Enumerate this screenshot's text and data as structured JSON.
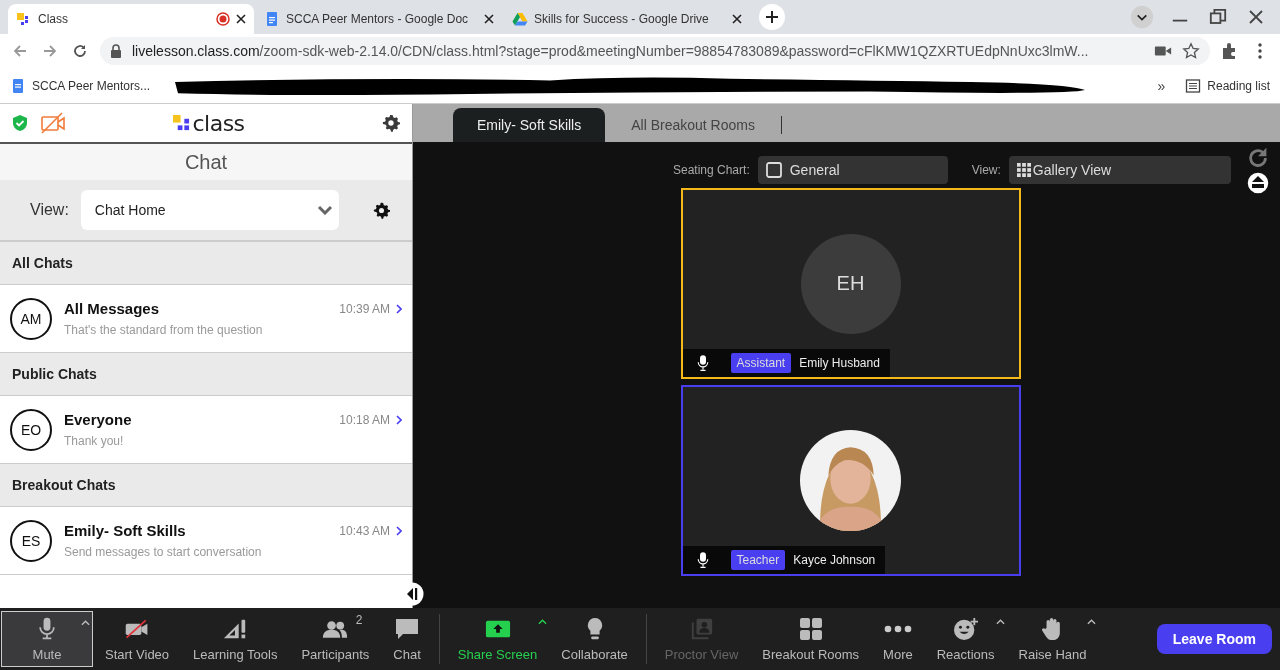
{
  "browser": {
    "tabs": [
      {
        "kind": "class",
        "title": "Class",
        "selected": true,
        "recording": true
      },
      {
        "kind": "doc",
        "title": "SCCA Peer Mentors - Google Doc",
        "selected": false,
        "recording": false
      },
      {
        "kind": "drive",
        "title": "Skills for Success - Google Drive",
        "selected": false,
        "recording": false
      }
    ],
    "url": {
      "host": "livelesson.class.com",
      "path": "/zoom-sdk-web-2.14.0/CDN/class.html?stage=prod&meetingNumber=98854783089&password=cFlKMW1QZXRTUEdpNnUxc3lmW..."
    },
    "bookmarks": [
      {
        "label": "SCCA Peer Mentors..."
      }
    ],
    "overflow": "»",
    "reading_list": "Reading list"
  },
  "logo": "class",
  "chat": {
    "title": "Chat",
    "view_label": "View:",
    "view_value": "Chat Home",
    "sections": [
      {
        "heading": "All Chats",
        "items": [
          {
            "initials": "AM",
            "name": "All Messages",
            "time": "10:39 AM",
            "preview": "That's the standard from the question"
          }
        ]
      },
      {
        "heading": "Public Chats",
        "items": [
          {
            "initials": "EO",
            "name": "Everyone",
            "time": "10:18 AM",
            "preview": "Thank you!"
          }
        ]
      },
      {
        "heading": "Breakout Chats",
        "items": [
          {
            "initials": "ES",
            "name": "Emily- Soft Skills",
            "time": "10:43 AM",
            "preview": "Send messages to start conversation"
          }
        ]
      }
    ]
  },
  "room_tabs": [
    {
      "label": "Emily- Soft Skills",
      "selected": true
    },
    {
      "label": "All Breakout Rooms",
      "selected": false
    }
  ],
  "seating": {
    "label": "Seating Chart:",
    "value": "General"
  },
  "view": {
    "label": "View:",
    "value": "Gallery View"
  },
  "tiles": [
    {
      "kind": "initials",
      "initials": "EH",
      "role": "Assistant",
      "name": "Emily Husband",
      "color": "#f5b81b"
    },
    {
      "kind": "picture",
      "role": "Teacher",
      "name": "Kayce Johnson",
      "color": "#4a3ff0"
    }
  ],
  "toolbar": [
    {
      "kind": "mic",
      "label": "Mute",
      "selected": true,
      "disabled": false,
      "caret": true
    },
    {
      "kind": "video",
      "label": "Start Video",
      "selected": false,
      "disabled": false,
      "caret": false
    },
    {
      "kind": "tools",
      "label": "Learning Tools",
      "selected": false,
      "disabled": false,
      "caret": false
    },
    {
      "kind": "participants",
      "label": "Participants",
      "badge": "2",
      "selected": false,
      "disabled": false,
      "caret": false
    },
    {
      "kind": "chat",
      "label": "Chat",
      "selected": false,
      "disabled": false,
      "caret": false
    },
    {
      "kind": "separator"
    },
    {
      "kind": "share",
      "label": "Share Screen",
      "selected": false,
      "disabled": false,
      "caret": true
    },
    {
      "kind": "bulb",
      "label": "Collaborate",
      "selected": false,
      "disabled": false,
      "caret": false
    },
    {
      "kind": "separator"
    },
    {
      "kind": "proctor",
      "label": "Proctor View",
      "selected": false,
      "disabled": true,
      "caret": false
    },
    {
      "kind": "rooms",
      "label": "Breakout Rooms",
      "selected": false,
      "disabled": false,
      "caret": false
    },
    {
      "kind": "more",
      "label": "More",
      "selected": false,
      "disabled": false,
      "caret": false
    },
    {
      "kind": "reactions",
      "label": "Reactions",
      "selected": false,
      "disabled": false,
      "caret": true
    },
    {
      "kind": "hand",
      "label": "Raise Hand",
      "selected": false,
      "disabled": false,
      "caret": true
    }
  ],
  "leave": "Leave Room"
}
